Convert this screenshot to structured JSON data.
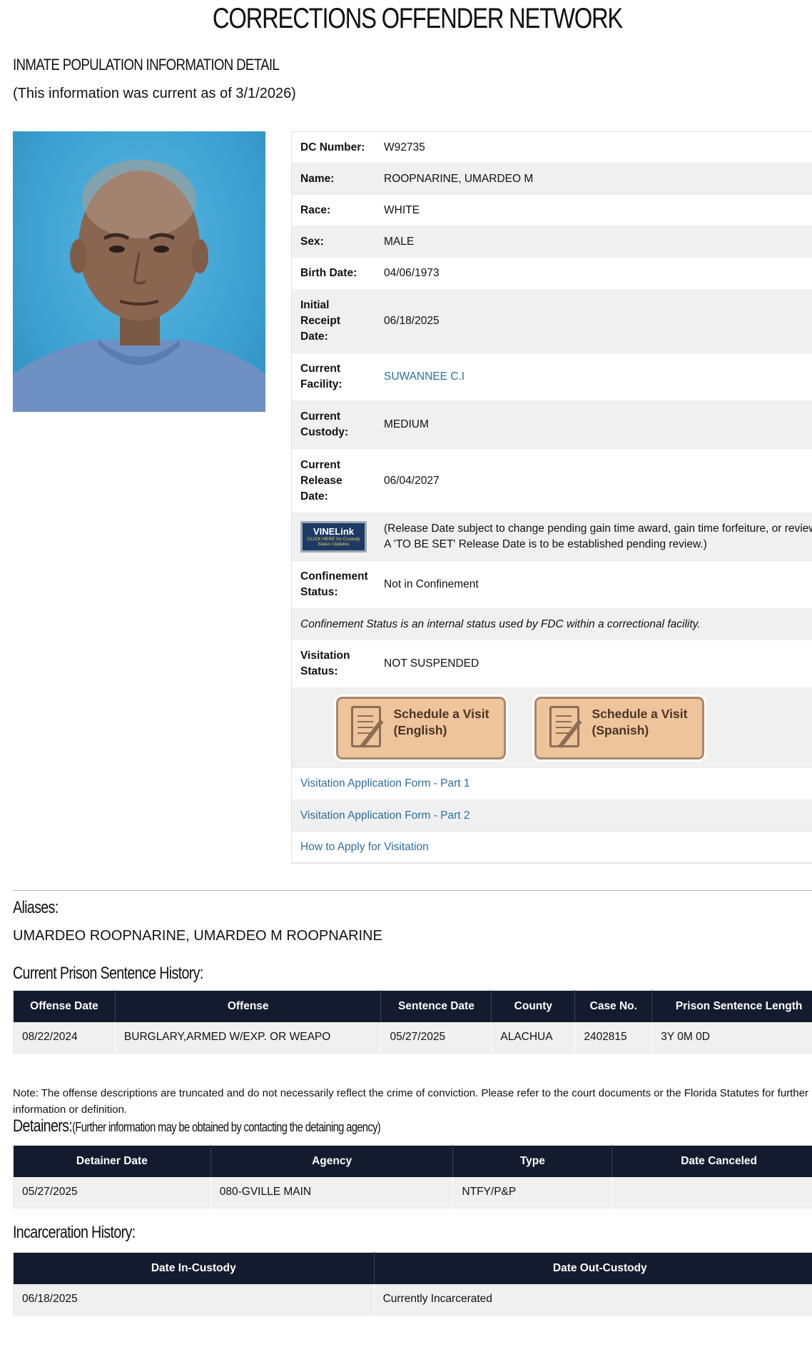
{
  "header": {
    "site_title": "CORRECTIONS OFFENDER NETWORK",
    "detail_heading": "INMATE POPULATION INFORMATION DETAIL",
    "as_of": "(This information was current as of 3/1/2026)"
  },
  "inmate": {
    "dc_number_label": "DC Number:",
    "dc_number": "W92735",
    "name_label": "Name:",
    "name": "ROOPNARINE, UMARDEO M",
    "race_label": "Race:",
    "race": "WHITE",
    "sex_label": "Sex:",
    "sex": "MALE",
    "birth_date_label": "Birth Date:",
    "birth_date": "04/06/1973",
    "initial_receipt_label_1": "Initial",
    "initial_receipt_label_2": "Receipt",
    "initial_receipt_label_3": "Date:",
    "initial_receipt_date": "06/18/2025",
    "facility_label_1": "Current",
    "facility_label_2": "Facility:",
    "facility": "SUWANNEE C.I",
    "custody_label_1": "Current",
    "custody_label_2": "Custody:",
    "custody": "MEDIUM",
    "release_label_1": "Current",
    "release_label_2": "Release",
    "release_label_3": "Date:",
    "release_date": "06/04/2027",
    "vine_title": "VINELink",
    "vine_sub": "CLICK HERE for Custody Status Updates",
    "release_note_1": "(Release Date subject to change pending gain time award, gain time forfeiture, or review.",
    "release_note_2": "A 'TO BE SET' Release Date is to be established pending review.)",
    "confinement_label_1": "Confinement",
    "confinement_label_2": "Status:",
    "confinement": "Not in Confinement",
    "confinement_note": "Confinement Status is an internal status used by FDC within a correctional facility.",
    "visitation_label_1": "Visitation",
    "visitation_label_2": "Status:",
    "visitation": "NOT SUSPENDED"
  },
  "visit_buttons": {
    "english_1": "Schedule a Visit",
    "english_2": "(English)",
    "spanish_1": "Schedule a Visit",
    "spanish_2": "(Spanish)"
  },
  "links": {
    "form_part1": "Visitation Application Form - Part 1",
    "form_part2": "Visitation Application Form - Part 2",
    "how_to_apply": "How to Apply for Visitation"
  },
  "aliases": {
    "title": "Aliases:",
    "text": "UMARDEO ROOPNARINE, UMARDEO M ROOPNARINE"
  },
  "sentence": {
    "title": "Current Prison Sentence History:",
    "headers": [
      "Offense Date",
      "Offense",
      "Sentence Date",
      "County",
      "Case No.",
      "Prison Sentence Length"
    ],
    "rows": [
      [
        "08/22/2024",
        "BURGLARY,ARMED W/EXP. OR WEAPO",
        "05/27/2025",
        "ALACHUA",
        "2402815",
        "3Y 0M 0D"
      ]
    ],
    "note": "Note: The offense descriptions are truncated and do not necessarily reflect the crime of conviction. Please refer to the court documents or the Florida Statutes for further information or definition."
  },
  "detainers": {
    "title": "Detainers:",
    "subtitle": "(Further information may be obtained by contacting the detaining agency)",
    "headers": [
      "Detainer Date",
      "Agency",
      "Type",
      "Date Canceled"
    ],
    "rows": [
      [
        "05/27/2025",
        "080-GVILLE MAIN",
        "NTFY/P&P",
        ""
      ]
    ]
  },
  "incarceration": {
    "title": "Incarceration History:",
    "headers": [
      "Date In-Custody",
      "Date Out-Custody"
    ],
    "rows": [
      [
        "06/18/2025",
        "Currently Incarcerated"
      ]
    ]
  }
}
